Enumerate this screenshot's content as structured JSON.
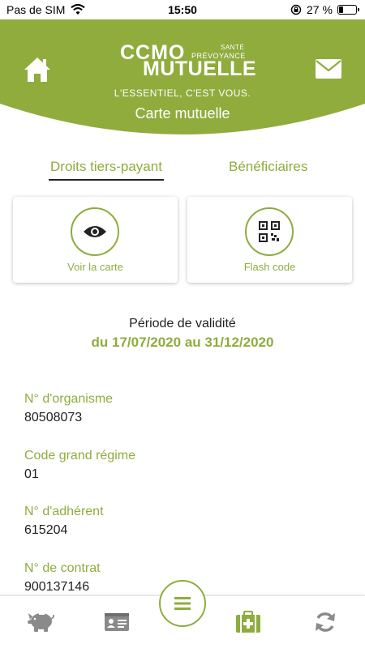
{
  "status_bar": {
    "carrier": "Pas de SIM",
    "time": "15:50",
    "battery_percent": "27 %",
    "battery_level": 0.27,
    "icons": [
      "wifi-icon",
      "rotation-lock-icon",
      "battery-icon"
    ]
  },
  "header": {
    "logo": {
      "line1": "CCMO",
      "sante": "SANTÉ",
      "prevoyance": "PRÉVOYANCE",
      "line2": "MUTUELLE"
    },
    "tagline": "L'ESSENTIEL, C'EST VOUS.",
    "title": "Carte mutuelle",
    "icons": [
      "home-icon",
      "mail-icon"
    ]
  },
  "tabs": [
    {
      "label": "Droits tiers-payant",
      "active": true
    },
    {
      "label": "Bénéficiaires",
      "active": false
    }
  ],
  "actions": [
    {
      "label": "Voir la carte",
      "icon": "eye-icon"
    },
    {
      "label": "Flash code",
      "icon": "qr-code-icon"
    }
  ],
  "validity": {
    "label": "Période de validité",
    "dates": "du 17/07/2020 au 31/12/2020"
  },
  "fields": [
    {
      "label": "N° d'organisme",
      "value": "80508073"
    },
    {
      "label": "Code grand régime",
      "value": "01"
    },
    {
      "label": "N° d'adhérent",
      "value": "615204"
    },
    {
      "label": "N° de contrat",
      "value": "900137146"
    }
  ],
  "bottom_nav": {
    "items": [
      {
        "icon": "piggy-bank-icon",
        "active": false
      },
      {
        "icon": "id-card-icon",
        "active": false
      },
      {
        "icon": "menu-icon",
        "active": false
      },
      {
        "icon": "medical-kit-icon",
        "active": true
      },
      {
        "icon": "refresh-icon",
        "active": false
      }
    ]
  },
  "colors": {
    "brand_green": "#8fac3d",
    "inactive_icon": "#8a8a8a",
    "text": "#222222"
  }
}
